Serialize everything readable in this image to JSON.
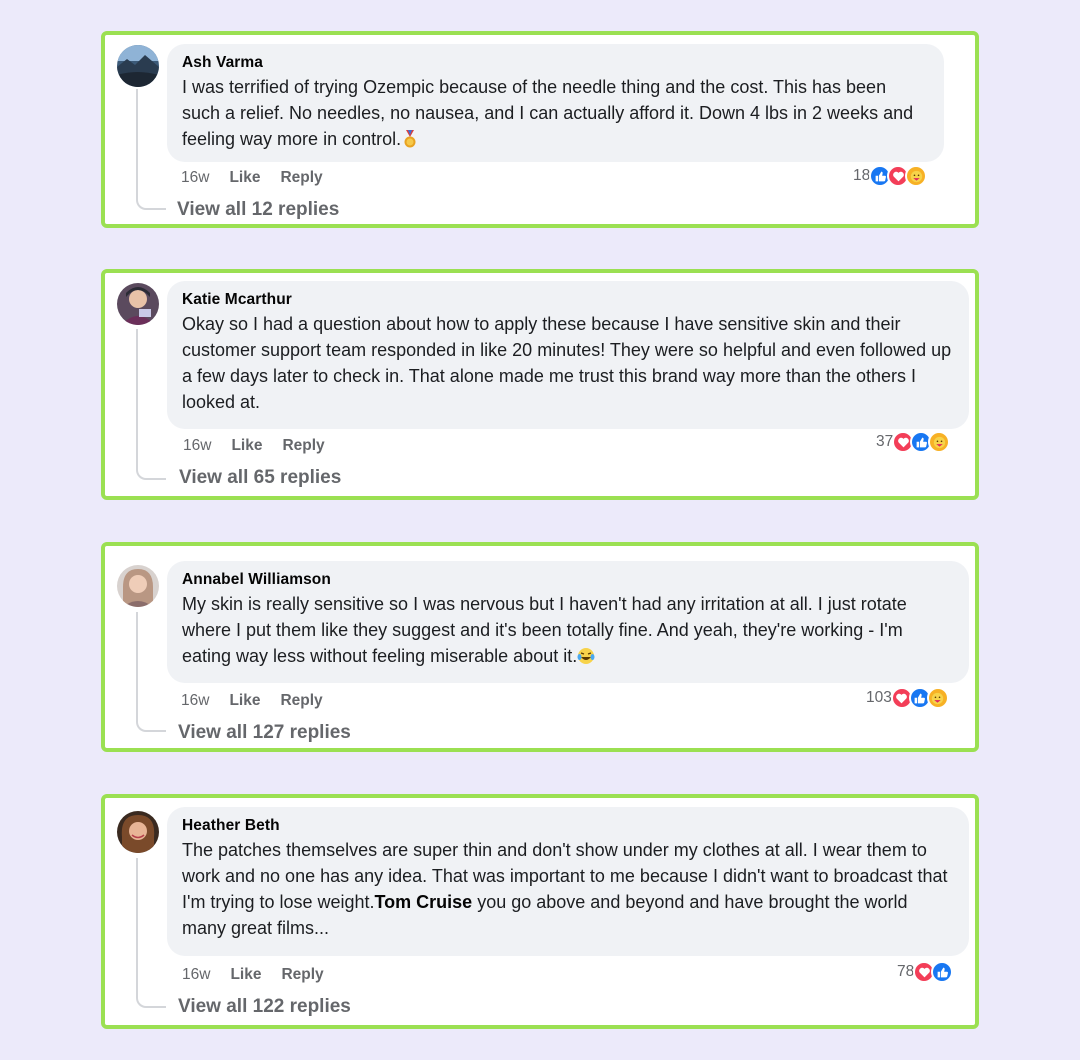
{
  "comments": [
    {
      "author": "Ash Varma",
      "text": "I was terrified of trying Ozempic because of the needle thing and the cost. This has been such a relief. No needles, no nausea, and I can actually afford it. Down 4 lbs in 2 weeks and feeling way more in control.",
      "emoji": "medal-icon",
      "time": "16w",
      "like_label": "Like",
      "reply_label": "Reply",
      "reaction_count": "18",
      "reactions": [
        "like",
        "love",
        "care"
      ],
      "replies_label": "View all 12 replies"
    },
    {
      "author": "Katie Mcarthur",
      "text": "Okay so I had a question about how to apply these because I have sensitive skin and their customer support team responded in like 20 minutes! They were so helpful and even followed up a few days later to check in. That alone made me trust this brand way more than the others I looked at.",
      "time": "16w",
      "like_label": "Like",
      "reply_label": "Reply",
      "reaction_count": "37",
      "reactions": [
        "love",
        "like",
        "care"
      ],
      "replies_label": "View all 65 replies"
    },
    {
      "author": "Annabel Williamson",
      "text": "My skin is really sensitive so I was nervous but I haven't had any irritation at all. I just rotate where I put them like they suggest and it's been totally fine. And yeah, they're working - I'm eating way less without feeling miserable about it.",
      "emoji": "laughing-tears-icon",
      "time": "16w",
      "like_label": "Like",
      "reply_label": "Reply",
      "reaction_count": "103",
      "reactions": [
        "love",
        "like",
        "care"
      ],
      "replies_label": "View all 127 replies"
    },
    {
      "author": "Heather Beth",
      "text": "The patches themselves are super thin and don't show under my clothes at all. I wear them to work and no one has any idea. That was important to me because I didn't want to broadcast that I'm trying to lose weight.",
      "mention": "Tom Cruise",
      "text_after_mention": " you go above and beyond and have brought the world many great films...",
      "time": "16w",
      "like_label": "Like",
      "reply_label": "Reply",
      "reaction_count": "78",
      "reactions": [
        "love",
        "like"
      ],
      "replies_label": "View all 122 replies"
    }
  ],
  "colors": {
    "page_background": "#eceafa",
    "card_border": "#9be052",
    "bubble_background": "#f0f2f5",
    "like_blue": "#1877f2",
    "love_red": "#f33e58",
    "care_yellow": "#f7b125",
    "meta_gray": "#65676b"
  }
}
